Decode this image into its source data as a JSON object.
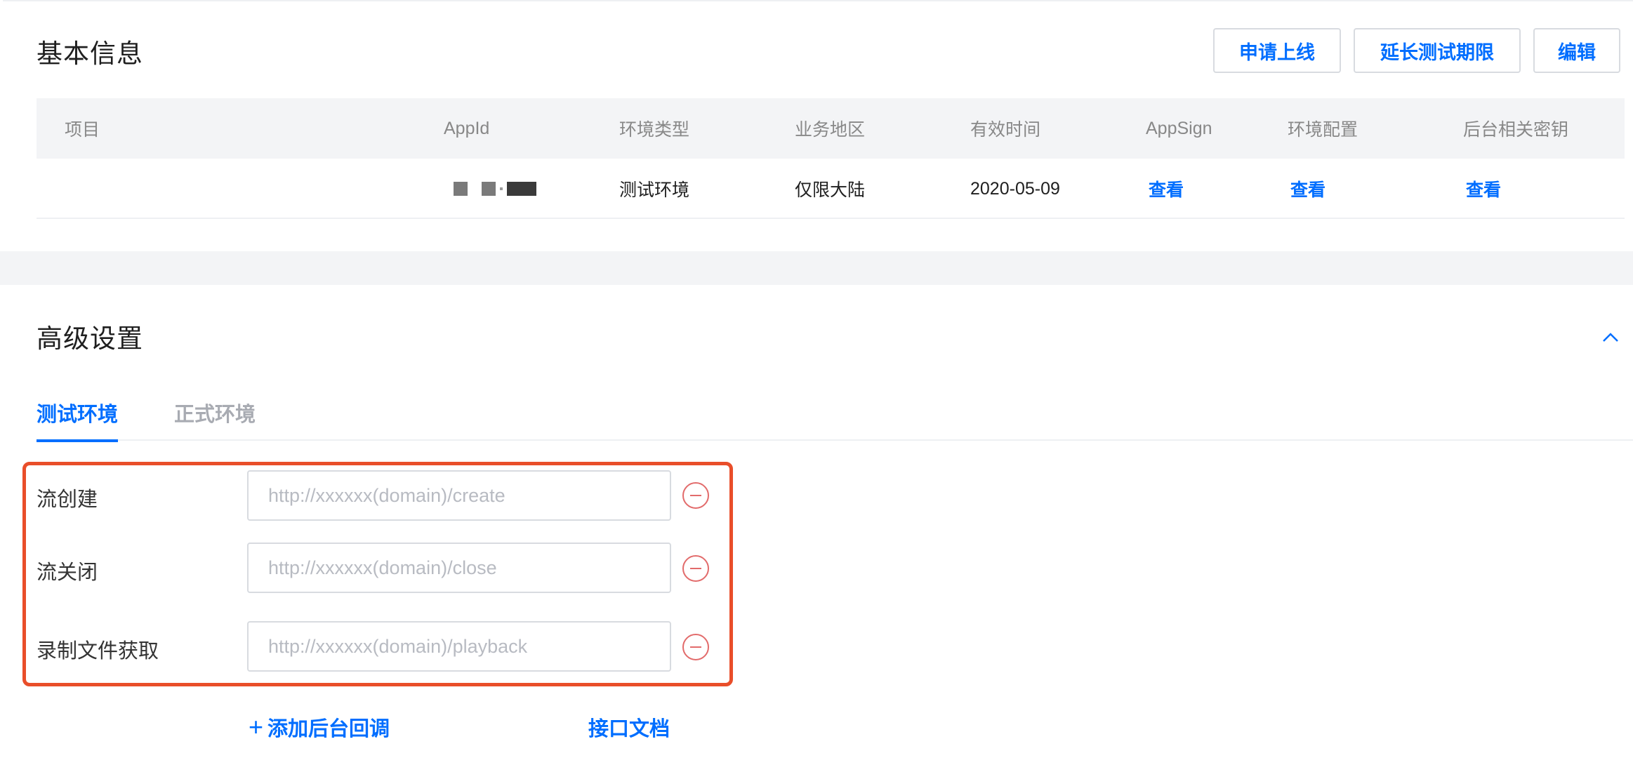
{
  "basic_info": {
    "title": "基本信息",
    "buttons": {
      "apply_online": "申请上线",
      "extend_test": "延长测试期限",
      "edit": "编辑"
    },
    "table": {
      "headers": {
        "project": "项目",
        "appid": "AppId",
        "env_type": "环境类型",
        "region": "业务地区",
        "valid_time": "有效时间",
        "appsign": "AppSign",
        "env_config": "环境配置",
        "backend_keys": "后台相关密钥"
      },
      "row": {
        "project": "",
        "env_type": "测试环境",
        "region": "仅限大陆",
        "valid_time": "2020-05-09",
        "appsign": "查看",
        "env_config": "查看",
        "backend_keys": "查看"
      }
    }
  },
  "advanced": {
    "title": "高级设置",
    "collapse_icon": "chevron-up-icon",
    "tabs": [
      {
        "label": "测试环境",
        "active": true
      },
      {
        "label": "正式环境",
        "active": false
      }
    ],
    "callbacks": [
      {
        "label": "流创建",
        "placeholder": "http://xxxxxx(domain)/create",
        "value": ""
      },
      {
        "label": "流关闭",
        "placeholder": "http://xxxxxx(domain)/close",
        "value": ""
      },
      {
        "label": "录制文件获取",
        "placeholder": "http://xxxxxx(domain)/playback",
        "value": ""
      }
    ],
    "add_callback": "添加后台回调",
    "api_doc": "接口文档"
  },
  "colors": {
    "accent": "#006eff",
    "highlight": "#e94e2a",
    "remove": "#e26b6b"
  }
}
